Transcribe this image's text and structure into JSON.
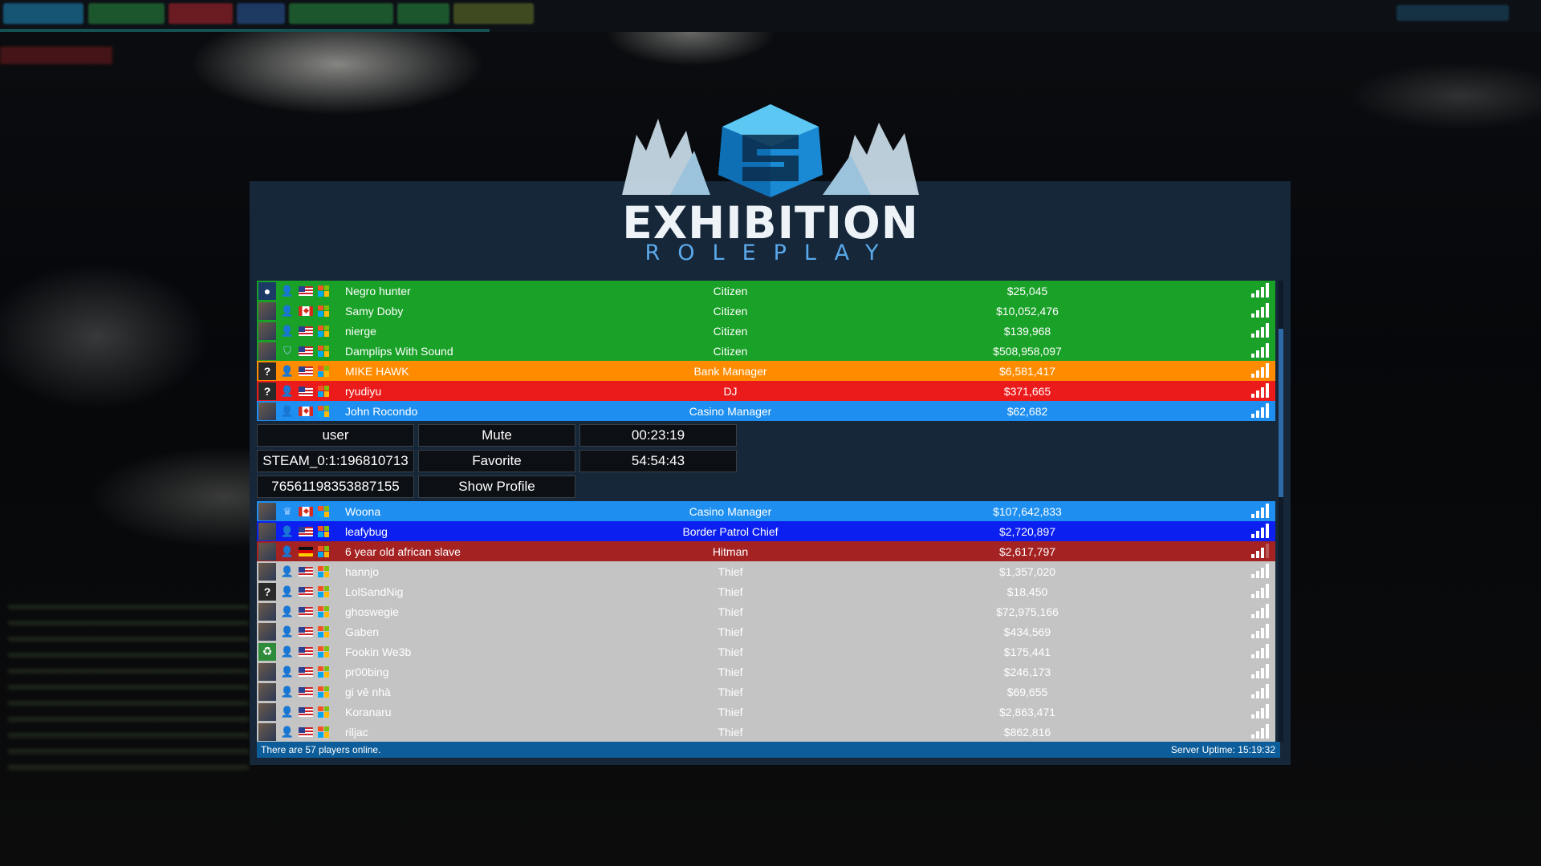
{
  "server": {
    "logo_title": "EXHIBITION",
    "logo_subtitle": "ROLEPLAY"
  },
  "colors": {
    "citizen": "#1aa128",
    "bank_manager": "#ff8c00",
    "dj": "#ec1b1b",
    "casino_manager": "#1e8ff0",
    "border_patrol_chief": "#0a1ff0",
    "hitman": "#a42222",
    "thief": "#c4c4c4"
  },
  "players_top": [
    {
      "avatar": "earth-icon",
      "rank": "user-icon",
      "flag": "us",
      "name": "Negro hunter",
      "job": "Citizen",
      "money": "$25,045",
      "color": "#1aa128",
      "ping": 4
    },
    {
      "avatar": "avatar",
      "rank": "user-icon",
      "flag": "ca",
      "name": "Samy Doby",
      "job": "Citizen",
      "money": "$10,052,476",
      "color": "#1aa128",
      "ping": 4
    },
    {
      "avatar": "avatar",
      "rank": "user-icon",
      "flag": "us",
      "name": "nierge",
      "job": "Citizen",
      "money": "$139,968",
      "color": "#1aa128",
      "ping": 4
    },
    {
      "avatar": "avatar",
      "rank": "shield-icon",
      "flag": "us",
      "name": "Damplips With Sound",
      "job": "Citizen",
      "money": "$508,958,097",
      "color": "#1aa128",
      "ping": 4
    },
    {
      "avatar": "?",
      "rank": "user-icon",
      "flag": "us",
      "name": "MIKE HAWK",
      "job": "Bank Manager",
      "money": "$6,581,417",
      "color": "#ff8c00",
      "ping": 4
    },
    {
      "avatar": "?",
      "rank": "user-icon",
      "flag": "us",
      "name": "ryudiyu",
      "job": "DJ",
      "money": "$371,665",
      "color": "#ec1b1b",
      "ping": 4
    },
    {
      "avatar": "avatar",
      "rank": "user-icon",
      "flag": "ca",
      "name": "John Rocondo",
      "job": "Casino Manager",
      "money": "$62,682",
      "color": "#1e8ff0",
      "ping": 4
    }
  ],
  "details": {
    "usergroup": "user",
    "mute_label": "Mute",
    "session_time": "00:23:19",
    "steam_id": "STEAM_0:1:196810713",
    "favorite_label": "Favorite",
    "total_time": "54:54:43",
    "steam_id64": "76561198353887155",
    "profile_label": "Show Profile"
  },
  "players_bottom": [
    {
      "avatar": "avatar",
      "rank": "crown-icon",
      "flag": "ca",
      "name": "Woona",
      "job": "Casino Manager",
      "money": "$107,642,833",
      "color": "#1e8ff0",
      "ping": 4
    },
    {
      "avatar": "avatar",
      "rank": "user-icon",
      "flag": "us",
      "name": "leafybug",
      "job": "Border Patrol Chief",
      "money": "$2,720,897",
      "color": "#0a1ff0",
      "ping": 4
    },
    {
      "avatar": "avatar",
      "rank": "user-icon",
      "flag": "de",
      "name": "6 year old african slave",
      "job": "Hitman",
      "money": "$2,617,797",
      "color": "#a42222",
      "ping": 3
    },
    {
      "avatar": "avatar",
      "rank": "user-icon",
      "flag": "us",
      "name": "hannjo",
      "job": "Thief",
      "money": "$1,357,020",
      "color": "#c4c4c4",
      "ping": 4
    },
    {
      "avatar": "?",
      "rank": "user-icon",
      "flag": "us",
      "name": "LolSandNig",
      "job": "Thief",
      "money": "$18,450",
      "color": "#c4c4c4",
      "ping": 4
    },
    {
      "avatar": "avatar",
      "rank": "user-icon",
      "flag": "us",
      "name": "ghoswegie",
      "job": "Thief",
      "money": "$72,975,166",
      "color": "#c4c4c4",
      "ping": 4
    },
    {
      "avatar": "avatar",
      "rank": "user-icon",
      "flag": "us",
      "name": "Gaben",
      "job": "Thief",
      "money": "$434,569",
      "color": "#c4c4c4",
      "ping": 4
    },
    {
      "avatar": "recycle-icon",
      "rank": "user-icon",
      "flag": "us",
      "name": "Fookin We3b",
      "job": "Thief",
      "money": "$175,441",
      "color": "#c4c4c4",
      "ping": 4
    },
    {
      "avatar": "avatar",
      "rank": "user-icon",
      "flag": "us",
      "name": "pr00bing",
      "job": "Thief",
      "money": "$246,173",
      "color": "#c4c4c4",
      "ping": 4
    },
    {
      "avatar": "avatar",
      "rank": "user-icon",
      "flag": "us",
      "name": "gi vê nhà",
      "job": "Thief",
      "money": "$69,655",
      "color": "#c4c4c4",
      "ping": 4
    },
    {
      "avatar": "avatar",
      "rank": "user-icon",
      "flag": "us",
      "name": "Koranaru",
      "job": "Thief",
      "money": "$2,863,471",
      "color": "#c4c4c4",
      "ping": 4
    },
    {
      "avatar": "avatar",
      "rank": "user-icon",
      "flag": "us",
      "name": "riljac",
      "job": "Thief",
      "money": "$862,816",
      "color": "#c4c4c4",
      "ping": 4
    }
  ],
  "footer": {
    "players_online": "There are 57 players online.",
    "uptime": "Server Uptime: 15:19:32"
  }
}
